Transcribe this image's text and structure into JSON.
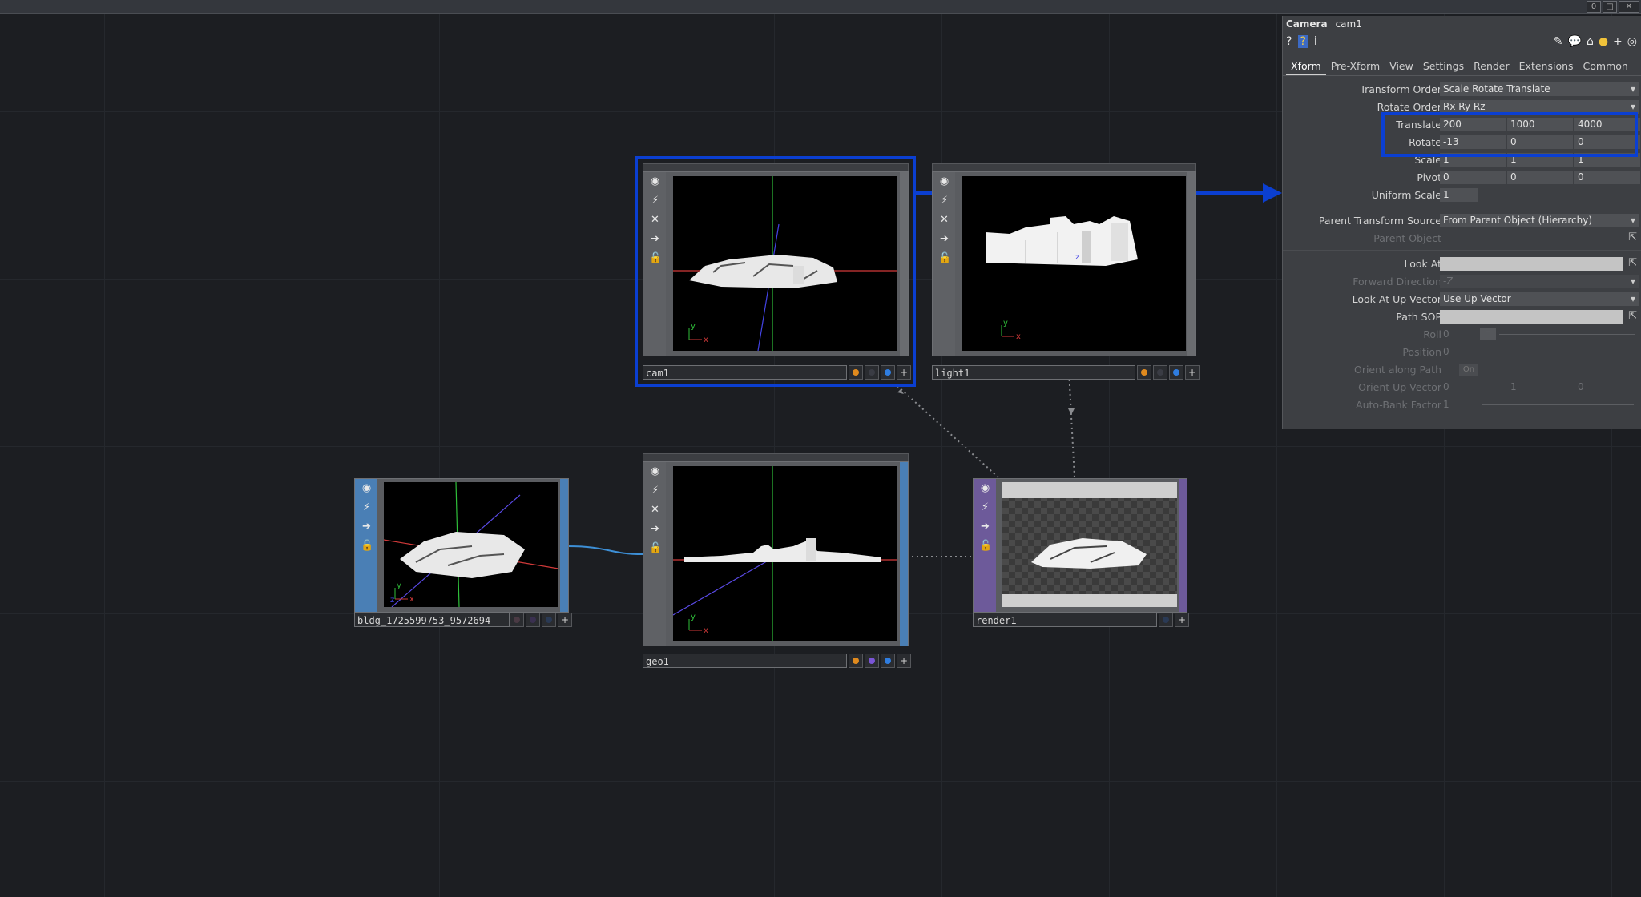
{
  "topbar": {
    "buttons": [
      "0",
      "□",
      "✕"
    ]
  },
  "nodes": {
    "cam1": {
      "label": "cam1"
    },
    "light1": {
      "label": "light1"
    },
    "bldg": {
      "label": "bldg_1725599753_9572694"
    },
    "geo1": {
      "label": "geo1"
    },
    "render1": {
      "label": "render1"
    }
  },
  "panel": {
    "type": "Camera",
    "name": "cam1",
    "tabs": [
      "Xform",
      "Pre-Xform",
      "View",
      "Settings",
      "Render",
      "Extensions",
      "Common"
    ],
    "params": {
      "transform_order": {
        "label": "Transform Order",
        "value": "Scale Rotate Translate"
      },
      "rotate_order": {
        "label": "Rotate Order",
        "value": "Rx Ry Rz"
      },
      "translate": {
        "label": "Translate",
        "x": "200",
        "y": "1000",
        "z": "4000"
      },
      "rotate": {
        "label": "Rotate",
        "x": "-13",
        "y": "0",
        "z": "0"
      },
      "scale": {
        "label": "Scale",
        "x": "1",
        "y": "1",
        "z": "1"
      },
      "pivot": {
        "label": "Pivot",
        "x": "0",
        "y": "0",
        "z": "0"
      },
      "uniform_scale": {
        "label": "Uniform Scale",
        "value": "1"
      },
      "parent_transform_source": {
        "label": "Parent Transform Source",
        "value": "From Parent Object (Hierarchy)"
      },
      "parent_object": {
        "label": "Parent Object"
      },
      "look_at": {
        "label": "Look At"
      },
      "forward_direction": {
        "label": "Forward Direction",
        "value": "-Z"
      },
      "look_at_up_vector": {
        "label": "Look At Up Vector",
        "value": "Use Up Vector"
      },
      "path_sop": {
        "label": "Path SOP"
      },
      "roll": {
        "label": "Roll",
        "value": "0"
      },
      "position": {
        "label": "Position",
        "value": "0"
      },
      "orient_along_path": {
        "label": "Orient along Path",
        "value": "On"
      },
      "orient_up_vector": {
        "label": "Orient Up Vector",
        "x": "0",
        "y": "1",
        "z": "0"
      },
      "auto_bank_factor": {
        "label": "Auto-Bank Factor",
        "value": "1"
      }
    }
  },
  "colors": {
    "highlight": "#0b3fd1",
    "dot_orange": "#e08a1e",
    "dot_purple": "#7a55d6",
    "dot_blue": "#2f7de0"
  }
}
